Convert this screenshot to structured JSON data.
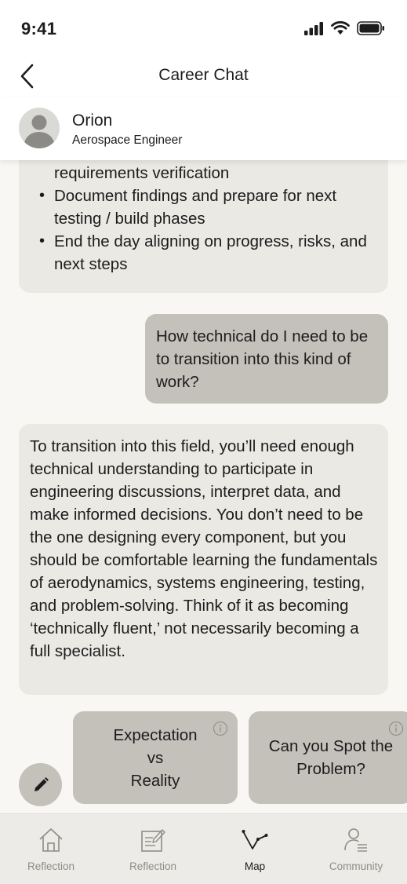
{
  "status_bar": {
    "time": "9:41"
  },
  "header": {
    "title": "Career Chat",
    "back_icon": "chevron-left-icon"
  },
  "contact": {
    "name": "Orion",
    "role": "Aerospace Engineer"
  },
  "messages": [
    {
      "sender": "Orion",
      "continued_text": "requirements verification",
      "bullets": [
        "Document findings and prepare for next testing / build phases",
        "End the day aligning on progress, risks, and next steps"
      ]
    },
    {
      "sender": "user",
      "text": "How technical do I need to be to transition into this kind of work?"
    },
    {
      "sender": "Orion",
      "text": "To transition into this field, you’ll need enough technical understanding to participate in engineering discussions, interpret data, and make informed decisions. You don’t need to be the one designing every component, but you should be comfortable learning the fundamentals of aerodynamics, systems engineering, testing, and problem-solving. Think of it as becoming ‘technically fluent,’ not necessarily becoming a full specialist."
    }
  ],
  "suggestions": [
    {
      "label": "Expectation\nvs\nReality",
      "icon": "info-icon"
    },
    {
      "label": "Can you Spot the\nProblem?",
      "icon": "info-icon"
    }
  ],
  "compose": {
    "icon": "pencil-icon"
  },
  "tabs": [
    {
      "label": "Reflection",
      "icon": "home-icon",
      "active": false
    },
    {
      "label": "Reflection",
      "icon": "edit-note-icon",
      "active": false
    },
    {
      "label": "Map",
      "icon": "path-map-icon",
      "active": true
    },
    {
      "label": "Community",
      "icon": "user-list-icon",
      "active": false
    }
  ],
  "colors": {
    "user_bubble": "#c3c1ba",
    "bot_bubble": "#ebe9e4",
    "background": "#f8f7f4",
    "tab_bar": "#ecebe7",
    "inactive_tab": "#8e8c86"
  }
}
